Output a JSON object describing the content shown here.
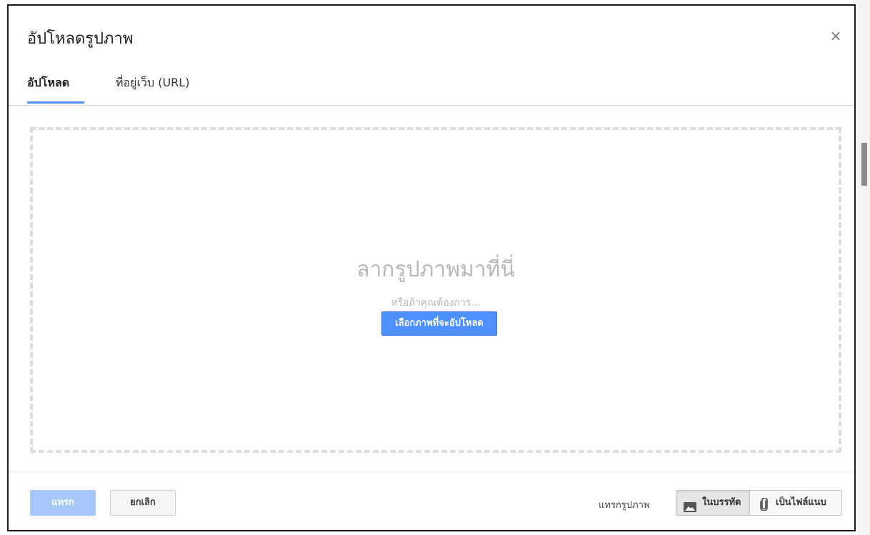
{
  "dialog": {
    "title": "อัปโหลดรูปภาพ",
    "close_glyph": "×"
  },
  "tabs": [
    {
      "label": "อัปโหลด",
      "active": true
    },
    {
      "label": "ที่อยู่เว็บ (URL)",
      "active": false
    }
  ],
  "dropzone": {
    "title": "ลากรูปภาพมาที่นี่",
    "or_text": "หรือถ้าคุณต้องการ...",
    "select_button": "เลือกภาพที่จะอัปโหลด"
  },
  "footer": {
    "insert_button": "แทรก",
    "cancel_button": "ยกเลิก",
    "insert_as_label": "แทรกรูปภาพ",
    "inline_option": "ในบรรทัด",
    "attachment_option": "เป็นไฟล์แนบ"
  },
  "colors": {
    "accent": "#4d90fe",
    "disabled_accent": "#a8c8fb"
  },
  "icons": {
    "close": "close-icon",
    "inline": "image-icon",
    "attachment": "paperclip-icon"
  }
}
